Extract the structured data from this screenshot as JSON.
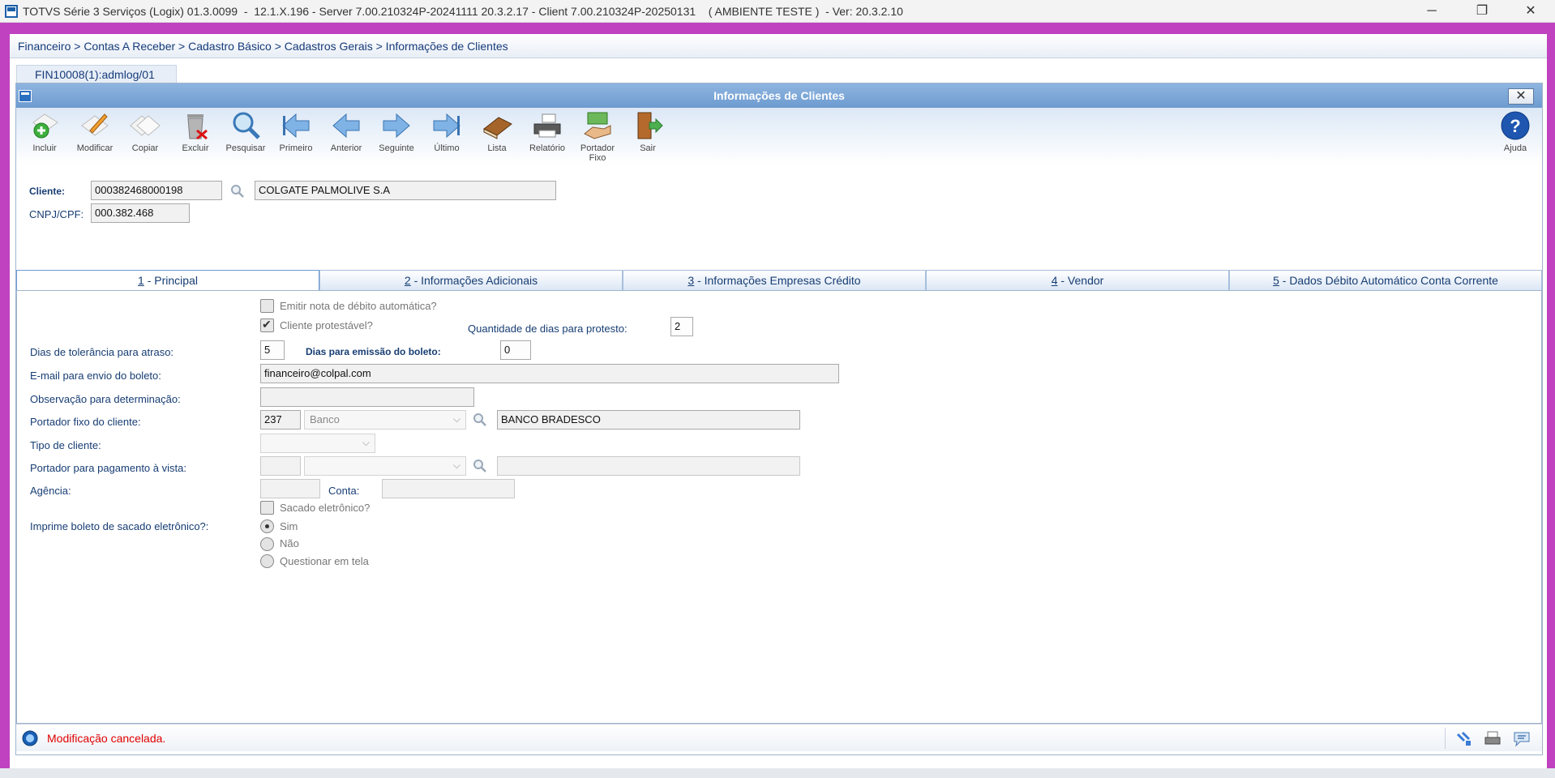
{
  "window": {
    "title": "TOTVS Série 3 Serviços (Logix) 01.3.0099  -  12.1.X.196 - Server 7.00.210324P-20241111 20.3.2.17 - Client 7.00.210324P-20250131    ( AMBIENTE TESTE )  - Ver: 20.3.2.10",
    "minimize": "─",
    "restore": "❐",
    "close": "✕"
  },
  "breadcrumb": "Financeiro > Contas A Receber > Cadastro Básico > Cadastros Gerais > Informações de Clientes",
  "process_tab": "FIN10008(1):admlog/01",
  "dialog": {
    "title": "Informações de Clientes",
    "close": "✕"
  },
  "toolbar": [
    {
      "id": "incluir",
      "label": "Incluir"
    },
    {
      "id": "modificar",
      "label": "Modificar"
    },
    {
      "id": "copiar",
      "label": "Copiar"
    },
    {
      "id": "excluir",
      "label": "Excluir"
    },
    {
      "id": "pesquisar",
      "label": "Pesquisar"
    },
    {
      "id": "primeiro",
      "label": "Primeiro"
    },
    {
      "id": "anterior",
      "label": "Anterior"
    },
    {
      "id": "seguinte",
      "label": "Seguinte"
    },
    {
      "id": "ultimo",
      "label": "Último"
    },
    {
      "id": "lista",
      "label": "Lista"
    },
    {
      "id": "relatorio",
      "label": "Relatório"
    },
    {
      "id": "portador",
      "label": "Portador Fixo"
    },
    {
      "id": "sair",
      "label": "Sair"
    }
  ],
  "help_label": "Ajuda",
  "header": {
    "cliente_label": "Cliente:",
    "cliente_code": "000382468000198",
    "cliente_name": "COLGATE PALMOLIVE S.A",
    "cnpj_label": "CNPJ/CPF:",
    "cnpj_value": "000.382.468"
  },
  "tabs": [
    {
      "num": "1",
      "text": " - Principal"
    },
    {
      "num": "2",
      "text": " - Informações Adicionais"
    },
    {
      "num": "3",
      "text": " - Informações Empresas Crédito"
    },
    {
      "num": "4",
      "text": " - Vendor"
    },
    {
      "num": "5",
      "text": " - Dados Débito Automático Conta Corrente"
    }
  ],
  "form": {
    "emitir_nota": "Emitir nota de débito automática?",
    "cliente_protestavel": "Cliente protestável?",
    "qtd_dias_protesto_label": "Quantidade de dias para protesto:",
    "qtd_dias_protesto": "2",
    "dias_tolerancia_label": "Dias de tolerância para atraso:",
    "dias_tolerancia": "5",
    "dias_emissao_label": "Dias para emissão do boleto:",
    "dias_emissao": "0",
    "email_label": "E-mail para envio do boleto:",
    "email": "financeiro@colpal.com",
    "observacao_label": "Observação para determinação:",
    "observacao": "",
    "portador_fixo_label": "Portador fixo do cliente:",
    "portador_fixo_code": "237",
    "portador_fixo_tipo": "Banco",
    "portador_fixo_nome": "BANCO BRADESCO",
    "tipo_cliente_label": "Tipo de cliente:",
    "portador_vista_label": "Portador para pagamento à vista:",
    "agencia_label": "Agência:",
    "conta_label": "Conta:",
    "sacado_eletronico": "Sacado eletrônico?",
    "imprime_label": "Imprime boleto de sacado eletrônico?:",
    "opt_sim": "Sim",
    "opt_nao": "Não",
    "opt_questionar": "Questionar em tela"
  },
  "status": {
    "message": "Modificação cancelada."
  }
}
